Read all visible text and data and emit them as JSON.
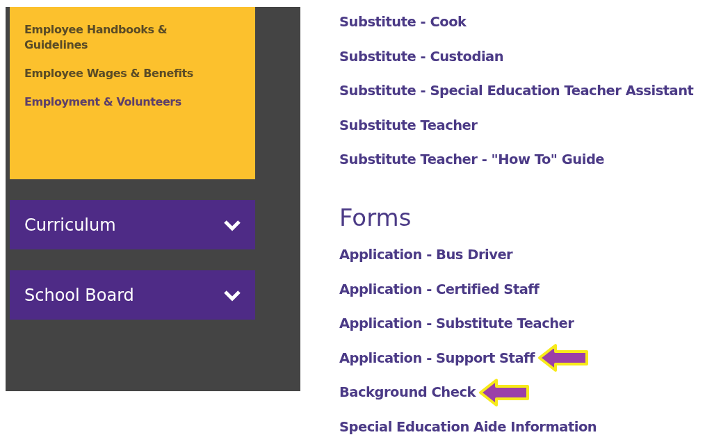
{
  "sidebar": {
    "submenu": [
      {
        "label": "Employee Handbooks & Guidelines",
        "selected": false
      },
      {
        "label": "Employee Wages & Benefits",
        "selected": false
      },
      {
        "label": "Employment & Volunteers",
        "selected": true
      }
    ],
    "sections": [
      {
        "label": "Curriculum",
        "expanded": false
      },
      {
        "label": "School Board",
        "expanded": false
      }
    ]
  },
  "content": {
    "links": [
      {
        "label": "Substitute - Cook",
        "highlighted": false
      },
      {
        "label": "Substitute - Custodian",
        "highlighted": false
      },
      {
        "label": "Substitute - Special Education Teacher Assistant",
        "highlighted": false
      },
      {
        "label": "Substitute Teacher",
        "highlighted": false
      },
      {
        "label": "Substitute Teacher - \"How To\" Guide",
        "highlighted": false
      }
    ],
    "forms": {
      "heading": "Forms",
      "links": [
        {
          "label": "Application - Bus Driver",
          "highlighted": false
        },
        {
          "label": "Application - Certified Staff",
          "highlighted": false
        },
        {
          "label": "Application - Substitute Teacher",
          "highlighted": false
        },
        {
          "label": "Application - Support Staff",
          "highlighted": true
        },
        {
          "label": "Background Check",
          "highlighted": true
        },
        {
          "label": "Special Education Aide Information",
          "highlighted": false
        }
      ]
    }
  }
}
